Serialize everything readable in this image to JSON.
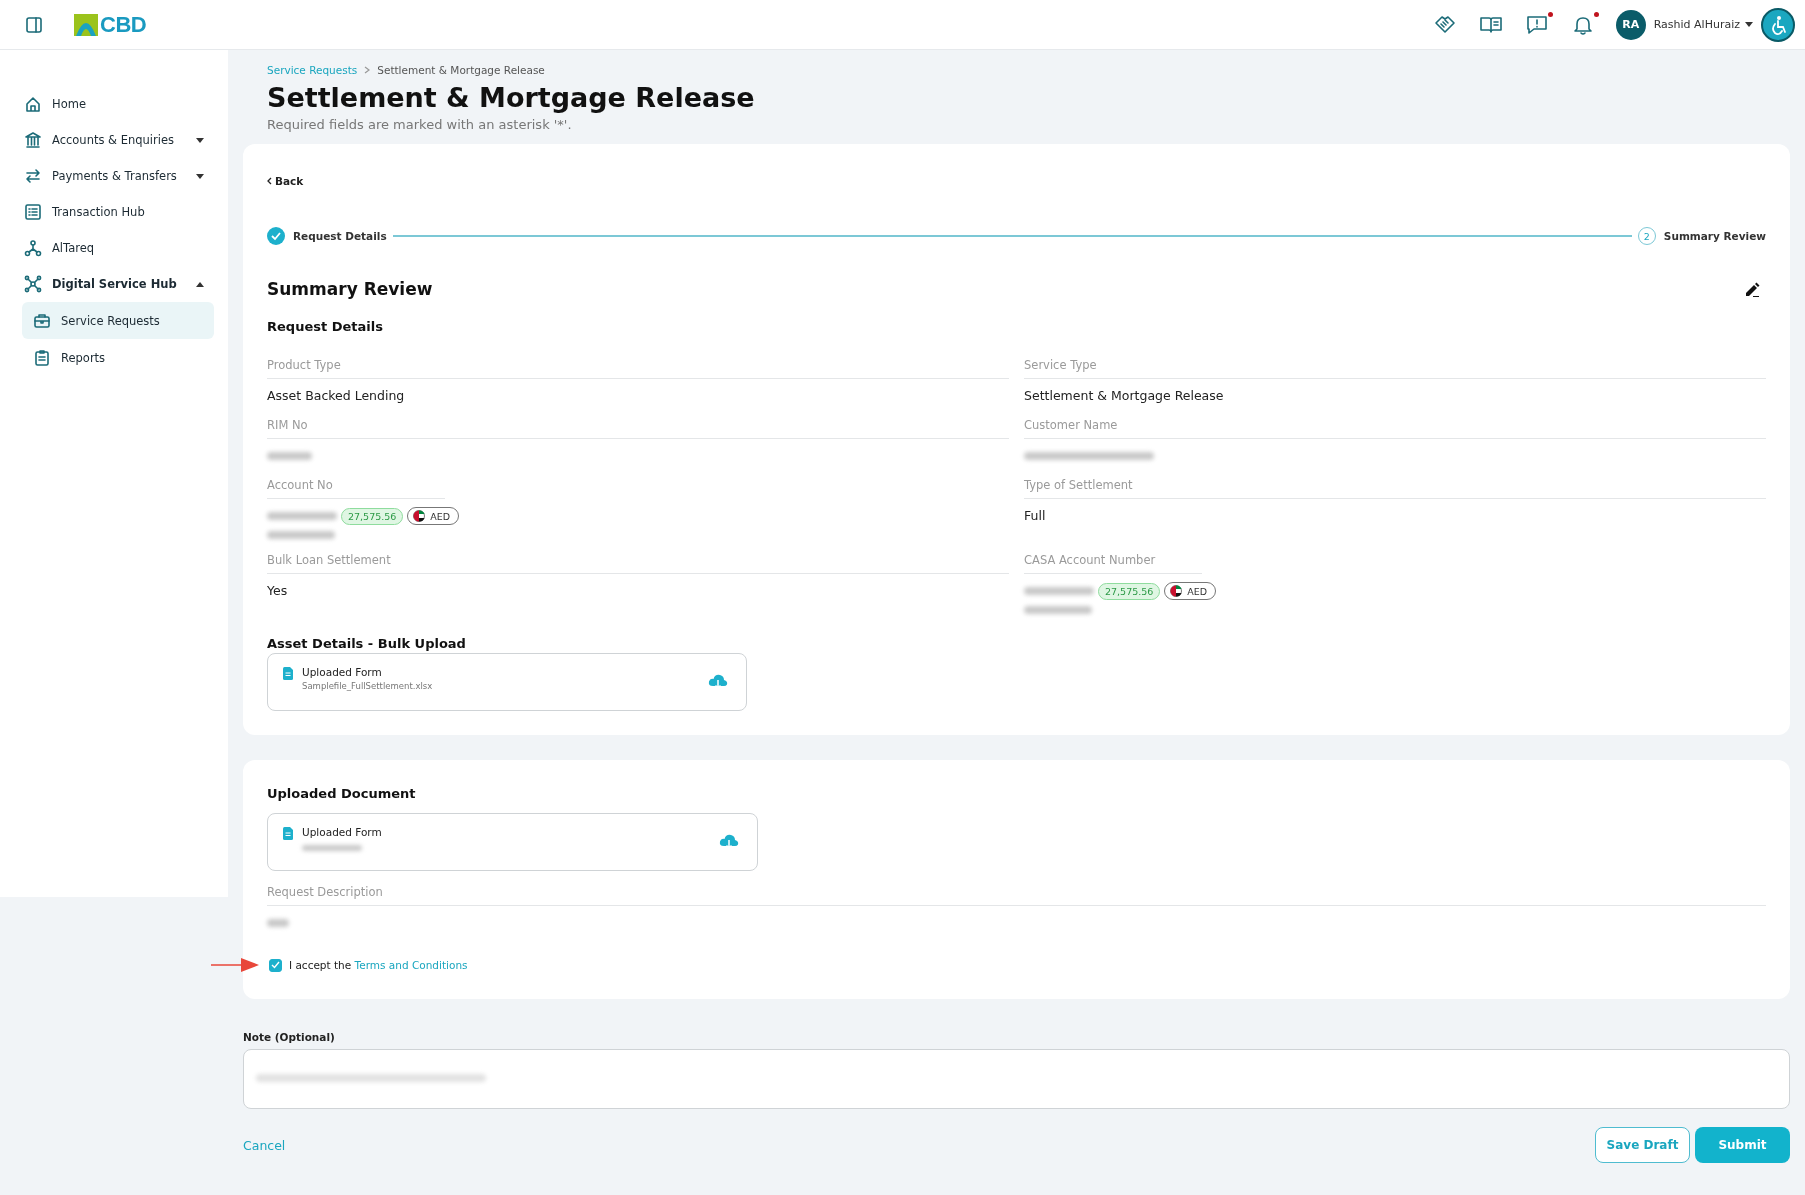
{
  "top_bar": {
    "logo_text": "CBD",
    "icons": [
      {
        "alert": false
      },
      {
        "alert": false
      },
      {
        "alert": true
      },
      {
        "alert": true
      }
    ],
    "avatar": "RA",
    "user_name": "Rashid AlHuraiz"
  },
  "sidebar": {
    "items": [
      {
        "label": "Home",
        "selected": false
      },
      {
        "label": "Accounts & Enquiries",
        "expanded": false,
        "selected": false
      },
      {
        "label": "Payments & Transfers",
        "expanded": false,
        "selected": false
      },
      {
        "label": "Transaction Hub",
        "selected": false
      },
      {
        "label": "AlTareq",
        "selected": false
      },
      {
        "label": "Digital Service Hub",
        "expanded": true,
        "selected": false,
        "children": [
          {
            "label": "Service Requests",
            "selected": true
          },
          {
            "label": "Reports",
            "selected": false
          }
        ]
      }
    ]
  },
  "breadcrumb": [
    {
      "label": "Service Requests",
      "kind": "link"
    },
    {
      "label": "Settlement & Mortgage Release",
      "kind": "current"
    }
  ],
  "page_title": "Settlement & Mortgage Release",
  "subtitle": "Required fields are marked with an asterisk '*'.",
  "back_link": "Back",
  "stepper": [
    {
      "label": "Request Details",
      "completed": true
    },
    {
      "label": "Summary Review",
      "completed": false,
      "number": "2"
    }
  ],
  "summary_title": "Summary Review",
  "section_title": "Request Details",
  "fields": [
    {
      "label": "Product Type",
      "kind": "text",
      "value": "Asset Backed Lending"
    },
    {
      "label": "Service Type",
      "kind": "text",
      "value": "Settlement & Mortgage Release"
    },
    {
      "label": "RIM No",
      "kind": "redacted"
    },
    {
      "label": "Customer Name",
      "kind": "redacted"
    },
    {
      "label": "Account No",
      "kind": "account",
      "balance": "27,575.56",
      "currency": "AED"
    },
    {
      "label": "Type of Settlement",
      "kind": "text",
      "value": "Full"
    },
    {
      "label": "Bulk Loan Settlement",
      "kind": "text",
      "value": "Yes"
    },
    {
      "label": "CASA Account Number",
      "kind": "account",
      "balance": "27,575.56",
      "currency": "AED"
    }
  ],
  "asset_section": {
    "title": "Asset Details - Bulk Upload",
    "file": {
      "title": "Uploaded Form",
      "filename": "Samplefile_FullSettlement.xlsx"
    }
  },
  "document_section": {
    "title": "Uploaded Document",
    "file": {
      "title": "Uploaded Form"
    },
    "description_label": "Request Description"
  },
  "terms": {
    "checked": true,
    "text": "I accept the ",
    "link": "Terms and Conditions"
  },
  "note": {
    "label": "Note (Optional)"
  },
  "actions": {
    "cancel": "Cancel",
    "save_draft": "Save Draft",
    "submit": "Submit"
  }
}
